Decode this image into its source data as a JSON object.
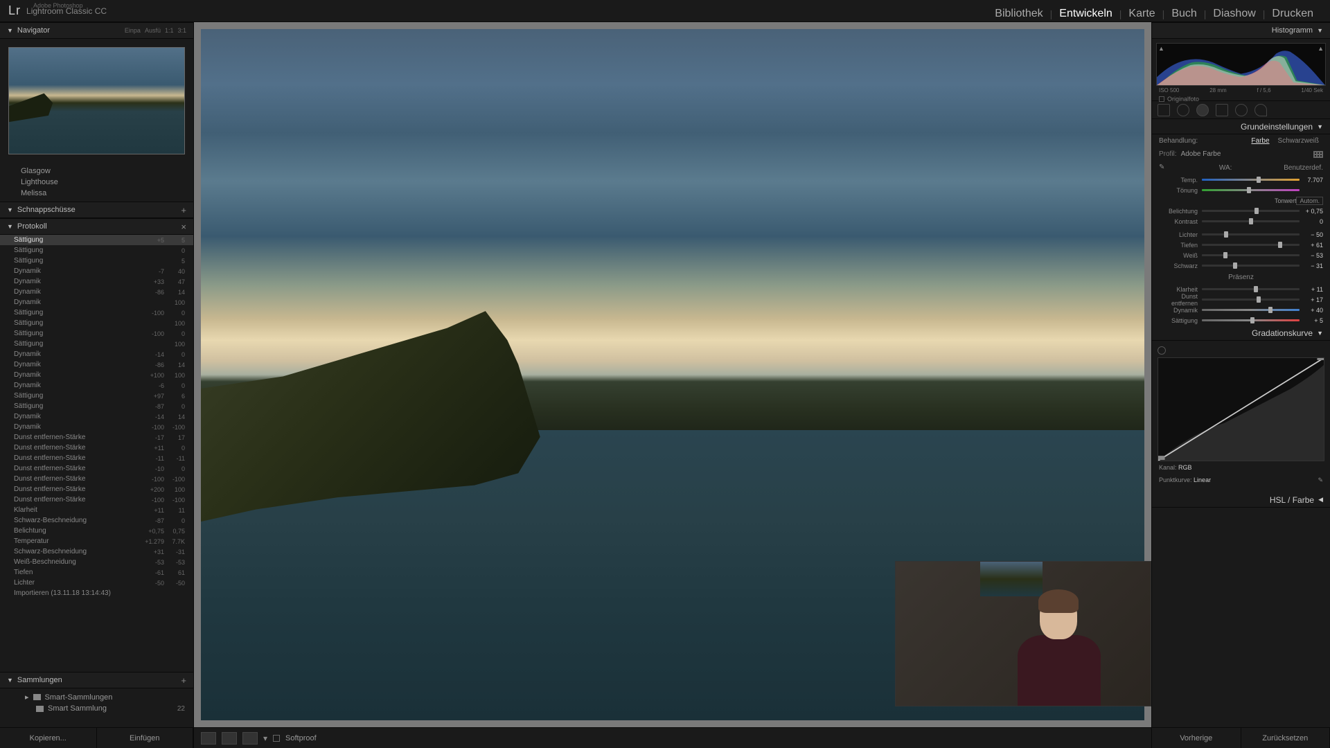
{
  "app": {
    "brand": "Lr",
    "subtitle": "Adobe Photoshop",
    "title": "Lightroom Classic CC"
  },
  "modules": {
    "items": [
      "Bibliothek",
      "Entwickeln",
      "Karte",
      "Buch",
      "Diashow",
      "Drucken"
    ],
    "active": 1
  },
  "navigator": {
    "title": "Navigator",
    "opts": [
      "Einpa",
      "Ausfü",
      "1:1",
      "3:1"
    ]
  },
  "presets": {
    "items": [
      "Glasgow",
      "Lighthouse",
      "Melissa"
    ]
  },
  "snapshots": {
    "title": "Schnappschüsse"
  },
  "history": {
    "title": "Protokoll",
    "rows": [
      {
        "n": "Sättigung",
        "a": "+5",
        "b": "5",
        "active": true
      },
      {
        "n": "Sättigung",
        "a": "",
        "b": "0"
      },
      {
        "n": "Sättigung",
        "a": "",
        "b": "5"
      },
      {
        "n": "Dynamik",
        "a": "-7",
        "b": "40"
      },
      {
        "n": "Dynamik",
        "a": "+33",
        "b": "47"
      },
      {
        "n": "Dynamik",
        "a": "-86",
        "b": "14"
      },
      {
        "n": "Dynamik",
        "a": "",
        "b": "100"
      },
      {
        "n": "Sättigung",
        "a": "-100",
        "b": "0"
      },
      {
        "n": "Sättigung",
        "a": "",
        "b": "100"
      },
      {
        "n": "Sättigung",
        "a": "-100",
        "b": "0"
      },
      {
        "n": "Sättigung",
        "a": "",
        "b": "100"
      },
      {
        "n": "Dynamik",
        "a": "-14",
        "b": "0"
      },
      {
        "n": "Dynamik",
        "a": "-86",
        "b": "14"
      },
      {
        "n": "Dynamik",
        "a": "+100",
        "b": "100"
      },
      {
        "n": "Dynamik",
        "a": "-6",
        "b": "0"
      },
      {
        "n": "Sättigung",
        "a": "+97",
        "b": "6"
      },
      {
        "n": "Sättigung",
        "a": "-87",
        "b": "0"
      },
      {
        "n": "Dynamik",
        "a": "-14",
        "b": "14"
      },
      {
        "n": "Dynamik",
        "a": "-100",
        "b": "-100"
      },
      {
        "n": "Dunst entfernen-Stärke",
        "a": "-17",
        "b": "17"
      },
      {
        "n": "Dunst entfernen-Stärke",
        "a": "+11",
        "b": "0"
      },
      {
        "n": "Dunst entfernen-Stärke",
        "a": "-11",
        "b": "-11"
      },
      {
        "n": "Dunst entfernen-Stärke",
        "a": "-10",
        "b": "0"
      },
      {
        "n": "Dunst entfernen-Stärke",
        "a": "-100",
        "b": "-100"
      },
      {
        "n": "Dunst entfernen-Stärke",
        "a": "+200",
        "b": "100"
      },
      {
        "n": "Dunst entfernen-Stärke",
        "a": "-100",
        "b": "-100"
      },
      {
        "n": "Klarheit",
        "a": "+11",
        "b": "11"
      },
      {
        "n": "Schwarz-Beschneidung",
        "a": "-87",
        "b": "0"
      },
      {
        "n": "Belichtung",
        "a": "+0,75",
        "b": "0,75"
      },
      {
        "n": "Temperatur",
        "a": "+1.279",
        "b": "7.7K"
      },
      {
        "n": "Schwarz-Beschneidung",
        "a": "+31",
        "b": "-31"
      },
      {
        "n": "Weiß-Beschneidung",
        "a": "-53",
        "b": "-53"
      },
      {
        "n": "Tiefen",
        "a": "-61",
        "b": "61"
      },
      {
        "n": "Lichter",
        "a": "-50",
        "b": "-50"
      },
      {
        "n": "Importieren (13.11.18 13:14:43)",
        "a": "",
        "b": ""
      }
    ]
  },
  "collections": {
    "title": "Sammlungen",
    "rows": [
      {
        "n": "Smart-Sammlungen",
        "c": ""
      },
      {
        "n": "Smart Sammlung",
        "c": "22"
      }
    ]
  },
  "leftBtns": {
    "copy": "Kopieren...",
    "paste": "Einfügen"
  },
  "toolbar": {
    "softproof": "Softproof"
  },
  "histogram": {
    "title": "Histogramm",
    "iso": "ISO 500",
    "focal": "28 mm",
    "aperture": "f / 5,6",
    "shutter": "1/40 Sek",
    "orig": "Originalfoto"
  },
  "basic": {
    "title": "Grundeinstellungen",
    "treat": {
      "lbl": "Behandlung:",
      "color": "Farbe",
      "bw": "Schwarzweiß"
    },
    "profile": {
      "lbl": "Profil:",
      "val": "Adobe Farbe"
    },
    "wb": {
      "lbl": "WA:",
      "val": "Benutzerdef."
    },
    "temp": {
      "lbl": "Temp.",
      "val": "7.707",
      "pos": 58
    },
    "tint": {
      "lbl": "Tönung",
      "val": "",
      "pos": 48
    },
    "tone": {
      "title": "Tonwert",
      "auto": "Autom."
    },
    "exposure": {
      "lbl": "Belichtung",
      "val": "+ 0,75",
      "pos": 56
    },
    "contrast": {
      "lbl": "Kontrast",
      "val": "0",
      "pos": 50
    },
    "highlights": {
      "lbl": "Lichter",
      "val": "− 50",
      "pos": 25
    },
    "shadows": {
      "lbl": "Tiefen",
      "val": "+ 61",
      "pos": 80
    },
    "whites": {
      "lbl": "Weiß",
      "val": "− 53",
      "pos": 24
    },
    "blacks": {
      "lbl": "Schwarz",
      "val": "− 31",
      "pos": 34
    },
    "presence": {
      "title": "Präsenz"
    },
    "clarity": {
      "lbl": "Klarheit",
      "val": "+ 11",
      "pos": 55
    },
    "dehaze": {
      "lbl": "Dunst entfernen",
      "val": "+ 17",
      "pos": 58
    },
    "vibrance": {
      "lbl": "Dynamik",
      "val": "+ 40",
      "pos": 70
    },
    "saturation": {
      "lbl": "Sättigung",
      "val": "+ 5",
      "pos": 52
    }
  },
  "curve": {
    "title": "Gradationskurve",
    "channel": "Kanal:",
    "rgb": "RGB",
    "pointcurve": "Punktkurve:",
    "linear": "Linear"
  },
  "hsl": {
    "title": "HSL / Farbe"
  },
  "rightBtns": {
    "prev": "Vorherige",
    "reset": "Zurücksetzen"
  }
}
